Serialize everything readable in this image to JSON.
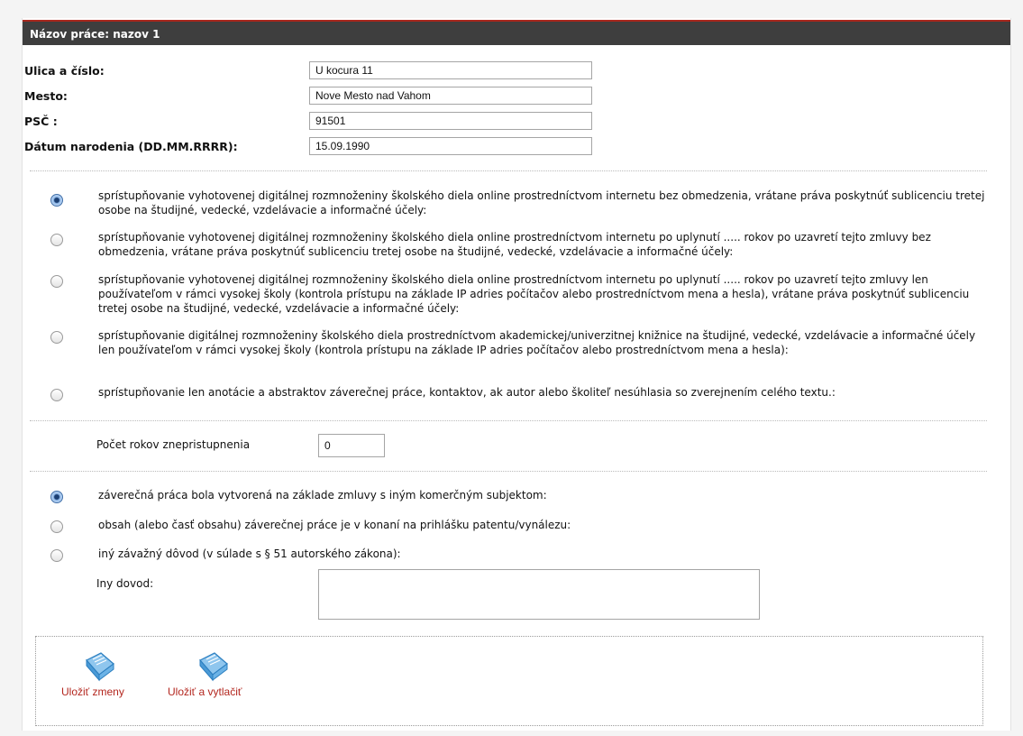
{
  "form": {
    "title": "Názov práce: nazov 1",
    "address": {
      "street_label": "Ulica a číslo:",
      "street_value": "U kocura 11",
      "city_label": "Mesto:",
      "city_value": "Nove Mesto nad Vahom",
      "zip_label": "PSČ :",
      "zip_value": "91501",
      "birth_label": "Dátum narodenia (DD.MM.RRRR):",
      "birth_value": "15.09.1990"
    },
    "access_options": [
      {
        "text": "sprístupňovanie vyhotovenej digitálnej rozmnoženiny školského diela online prostredníctvom internetu bez obmedzenia, vrátane práva poskytnúť sublicenciu tretej osobe na študijné, vedecké, vzdelávacie a informačné účely:",
        "selected": true
      },
      {
        "text": "sprístupňovanie vyhotovenej digitálnej rozmnoženiny školského diela online prostredníctvom internetu po uplynutí ..... rokov po uzavretí tejto zmluvy bez obmedzenia, vrátane práva poskytnúť sublicenciu tretej osobe na študijné, vedecké, vzdelávacie a informačné účely:",
        "selected": false
      },
      {
        "text": "sprístupňovanie vyhotovenej digitálnej rozmnoženiny školského diela online prostredníctvom internetu po uplynutí ..... rokov po uzavretí tejto zmluvy len používateľom v rámci vysokej školy (kontrola prístupu na základe IP adries počítačov alebo prostredníctvom mena a hesla), vrátane práva poskytnúť sublicenciu tretej osobe na študijné, vedecké, vzdelávacie a informačné účely:",
        "selected": false
      },
      {
        "text": "sprístupňovanie digitálnej rozmnoženiny školského diela prostredníctvom akademickej/univerzitnej knižnice na študijné, vedecké, vzdelávacie a informačné účely len používateľom v rámci vysokej školy (kontrola prístupu na základe IP adries počítačov alebo prostredníctvom mena a hesla):",
        "selected": false
      },
      {
        "text": "sprístupňovanie len anotácie a abstraktov záverečnej práce, kontaktov, ak autor alebo školiteľ nesúhlasia so zverejnením celého textu.:",
        "selected": false
      }
    ],
    "years_label": "Počet rokov znepristupnenia",
    "years_value": "0",
    "reason_options": [
      {
        "text": "záverečná práca bola vytvorená na základe zmluvy s iným komerčným subjektom:",
        "selected": true
      },
      {
        "text": "obsah (alebo časť obsahu) záverečnej práce je v konaní na prihlášku patentu/vynálezu:",
        "selected": false
      },
      {
        "text": "iný závažný dôvod (v súlade s § 51 autorského zákona):",
        "selected": false
      }
    ],
    "other_reason_label": "Iny dovod:",
    "other_reason_value": ""
  },
  "actions": {
    "save_label": "Uložiť zmeny",
    "save_print_label": "Uložiť a vytlačiť",
    "icon": "document-save-icon"
  },
  "colors": {
    "header_bg": "#3e3e3e",
    "header_accent": "#a8281e",
    "action_link": "#b3261e",
    "radio_selected": "#3f6ea8"
  }
}
